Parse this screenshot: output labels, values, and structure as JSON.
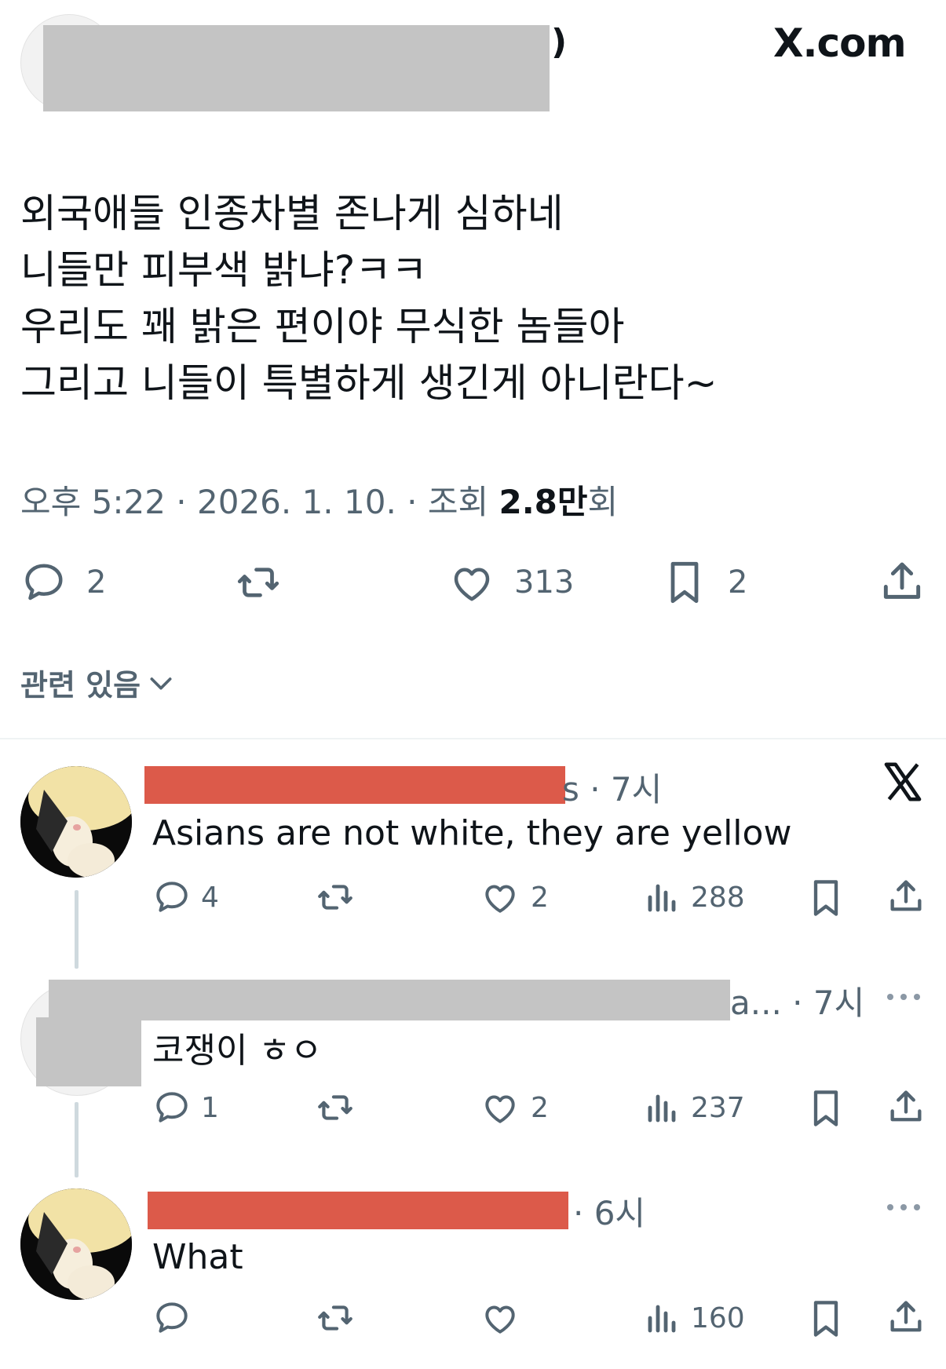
{
  "brand": {
    "logo_text": "X.com"
  },
  "main_post": {
    "author_name_tail": ")",
    "body_lines": [
      "외국애들 인종차별 존나게 심하네",
      "니들만 피부색 밝냐?ㅋㅋ",
      "우리도 꽤 밝은 편이야 무식한 놈들아",
      "그리고 니들이 특별하게 생긴게 아니란다~"
    ],
    "meta_prefix": "오후 5:22 · 2026. 1. 10. · 조회 ",
    "views_value": "2.8만",
    "views_suffix": "회",
    "stats": {
      "replies": "2",
      "likes": "313",
      "bookmarks": "2"
    }
  },
  "related_label": "관련 있음",
  "replies": [
    {
      "handle_tail": "s · 7시",
      "text": "Asians are not white, they are yellow",
      "stats": {
        "replies": "4",
        "likes": "2",
        "views": "288"
      }
    },
    {
      "handle_tail": "a... · 7시",
      "text": "코쟁이 ㅎㅇ",
      "stats": {
        "replies": "1",
        "likes": "2",
        "views": "237"
      }
    },
    {
      "handle_tail": "· 6시",
      "text": "What",
      "stats": {
        "views": "160"
      }
    }
  ],
  "colors": {
    "redaction_red": "#dc5a4a",
    "redaction_gray": "#c4c4c4",
    "text_muted": "#536471"
  }
}
